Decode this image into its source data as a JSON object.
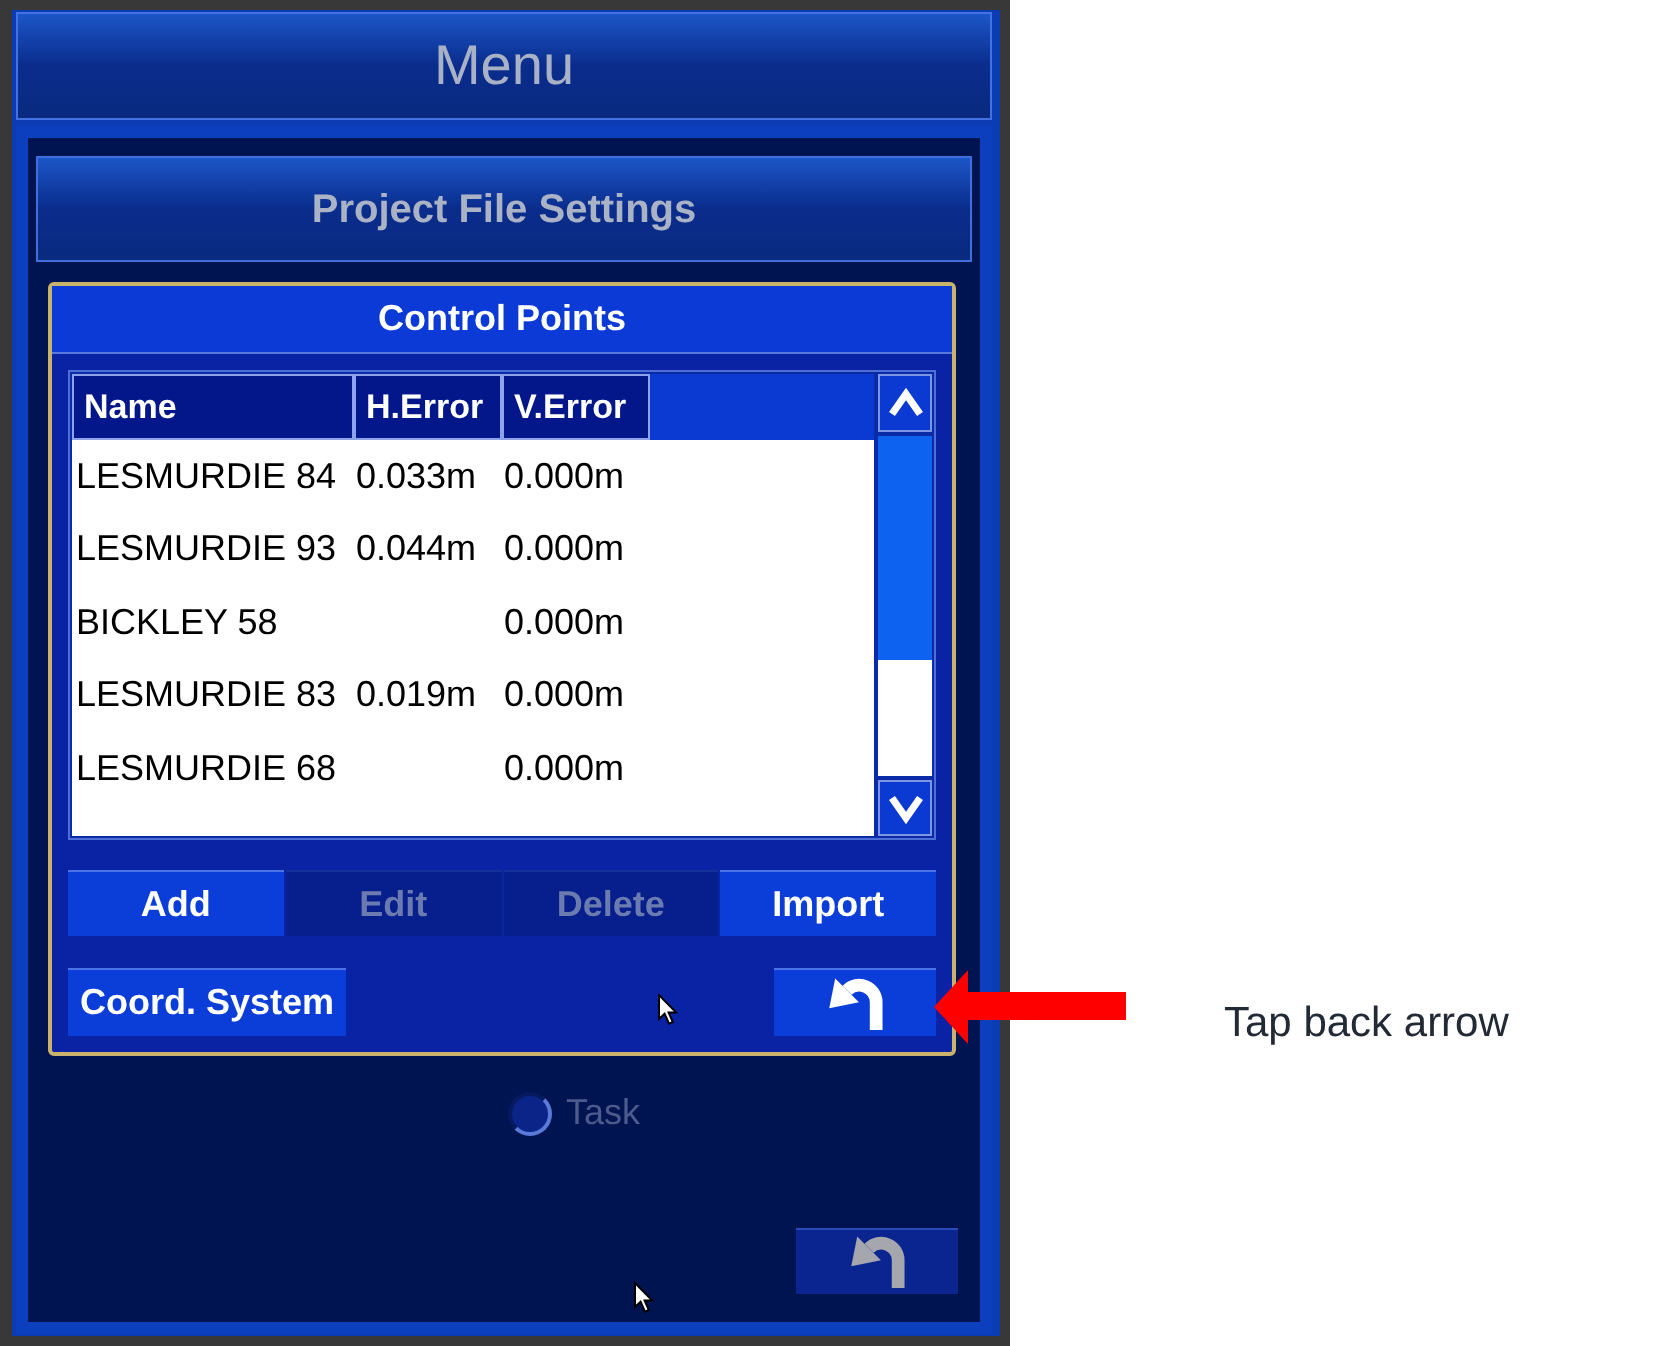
{
  "header": {
    "title": "Menu"
  },
  "section": {
    "title": "Project File Settings"
  },
  "dialog": {
    "title": "Control Points",
    "table": {
      "columns": [
        "Name",
        "H.Error",
        "V.Error"
      ],
      "rows": [
        {
          "name": "LESMURDIE 84",
          "h_error": "0.033m",
          "v_error": "0.000m"
        },
        {
          "name": "LESMURDIE 93",
          "h_error": "0.044m",
          "v_error": "0.000m"
        },
        {
          "name": "BICKLEY 58",
          "v_error": "0.000m"
        },
        {
          "name": "LESMURDIE 83",
          "h_error": "0.019m",
          "v_error": "0.000m"
        },
        {
          "name": "LESMURDIE 68",
          "v_error": "0.000m"
        }
      ]
    },
    "actions": [
      {
        "label": "Add",
        "disabled": false
      },
      {
        "label": "Edit",
        "disabled": true
      },
      {
        "label": "Delete",
        "disabled": true
      },
      {
        "label": "Import",
        "disabled": false
      }
    ],
    "coord_button": {
      "label": "Coord. System"
    }
  },
  "options": [
    {
      "label": "Task",
      "selected": false
    }
  ],
  "annotation": {
    "label": "Tap back arrow"
  }
}
